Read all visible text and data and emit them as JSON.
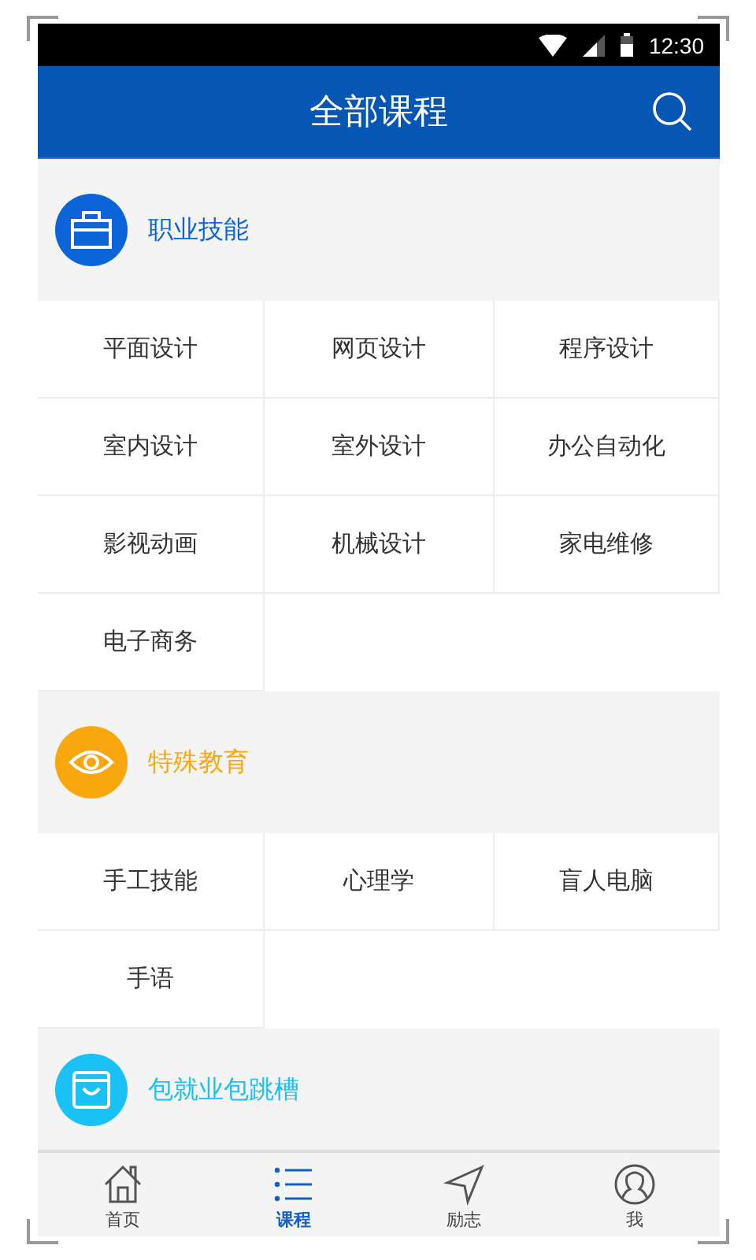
{
  "status_bar": {
    "time": "12:30"
  },
  "header": {
    "title": "全部课程"
  },
  "categories": [
    {
      "title": "职业技能",
      "kind": "briefcase",
      "color": "#0b65d9",
      "items": [
        "平面设计",
        "网页设计",
        "程序设计",
        "室内设计",
        "室外设计",
        "办公自动化",
        "影视动画",
        "机械设计",
        "家电维修",
        "电子商务"
      ]
    },
    {
      "title": "特殊教育",
      "kind": "eye",
      "color": "#f9a70f",
      "items": [
        "手工技能",
        "心理学",
        "盲人电脑",
        "手语"
      ]
    },
    {
      "title": "包就业包跳槽",
      "kind": "bag",
      "color": "#1ac1f4"
    }
  ],
  "tab_bar": [
    {
      "label": "首页",
      "kind": "home",
      "selected": false
    },
    {
      "label": "课程",
      "kind": "list",
      "selected": true
    },
    {
      "label": "励志",
      "kind": "navigate",
      "selected": false
    },
    {
      "label": "我",
      "kind": "user",
      "selected": false
    }
  ]
}
